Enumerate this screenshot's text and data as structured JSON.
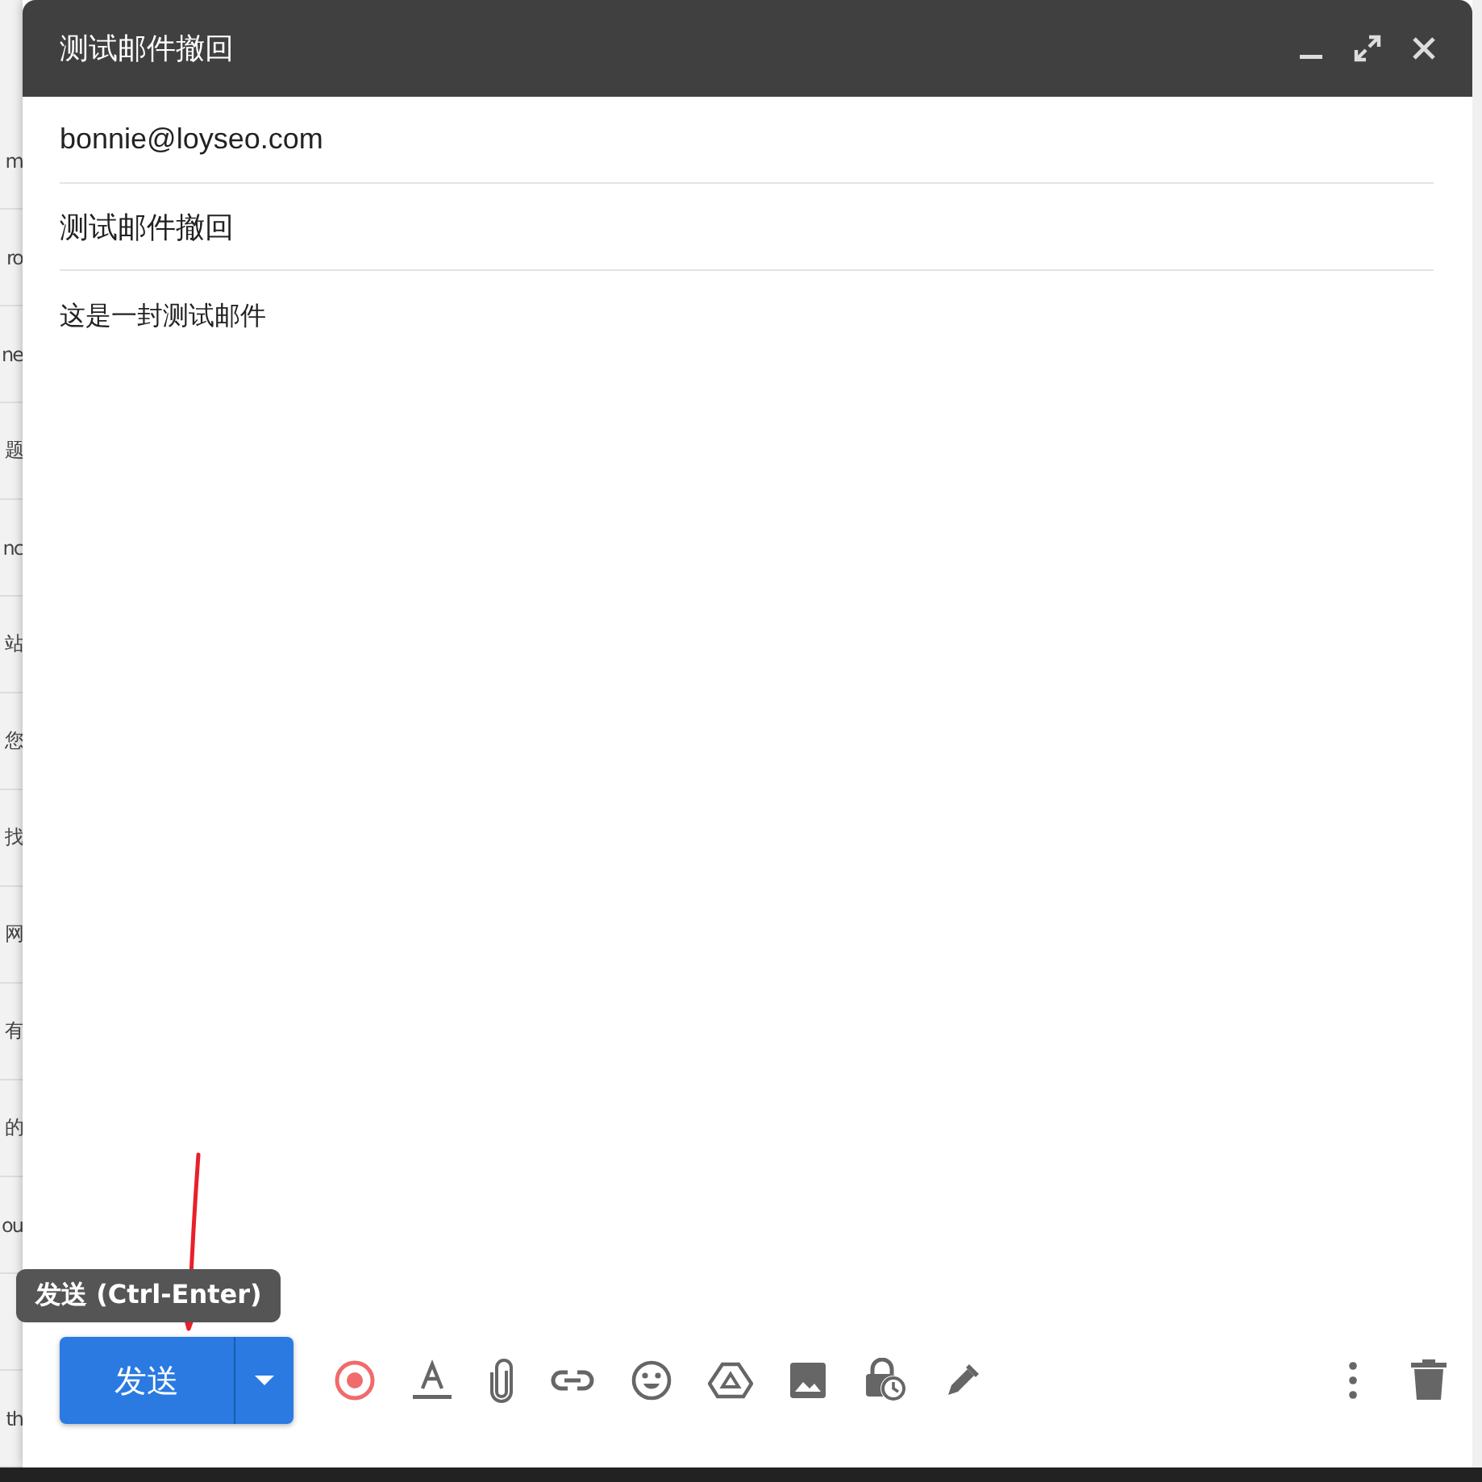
{
  "background_list": {
    "rows": [
      "m",
      "ro",
      "ne",
      "题",
      "nc",
      "站",
      "您",
      "找",
      "网",
      "有",
      "的",
      "ou",
      "th"
    ]
  },
  "compose": {
    "title": "测试邮件撤回",
    "to": "bonnie@loyseo.com",
    "subject": "测试邮件撤回",
    "body": "这是一封测试邮件",
    "send_button": "发送",
    "tooltip": "发送 (Ctrl-Enter)"
  }
}
